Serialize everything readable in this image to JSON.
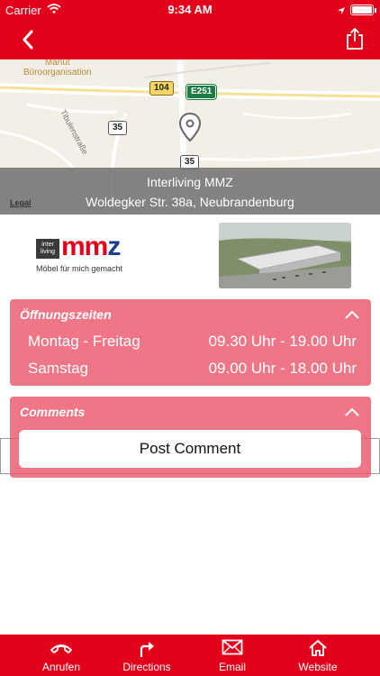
{
  "status_bar": {
    "carrier": "Carrier",
    "time": "9:34 AM",
    "battery_level": 1.0
  },
  "nav": {
    "back_icon": "chevron-left-icon",
    "share_icon": "share-icon"
  },
  "map": {
    "labels": {
      "poi": "Manut\nBüroorganisation",
      "street": "Tibulenstraße"
    },
    "roads": [
      "104",
      "E251",
      "35",
      "35"
    ],
    "store_name": "Interliving MMZ",
    "address": "Woldegker Str. 38a, Neubrandenburg",
    "legal": "Legal"
  },
  "logo": {
    "brand_box": "inter living",
    "brand": "mm",
    "brand_z": "z",
    "tagline": "Möbel für mich gemacht"
  },
  "hours": {
    "title": "Öffnungszeiten",
    "rows": [
      {
        "day": "Montag - Freitag",
        "time": "09.30 Uhr - 19.00 Uhr"
      },
      {
        "day": "Samstag",
        "time": "09.00 Uhr - 18.00 Uhr"
      }
    ]
  },
  "comments": {
    "title": "Comments",
    "post_button": "Post Comment"
  },
  "tabs": [
    {
      "label": "Anrufen",
      "icon": "phone-icon"
    },
    {
      "label": "Directions",
      "icon": "directions-arrow-icon"
    },
    {
      "label": "Email",
      "icon": "envelope-icon"
    },
    {
      "label": "Website",
      "icon": "home-icon"
    }
  ],
  "colors": {
    "brand_red": "#e3001b",
    "panel": "#ea5468",
    "overlay": "#6e6e6e"
  }
}
